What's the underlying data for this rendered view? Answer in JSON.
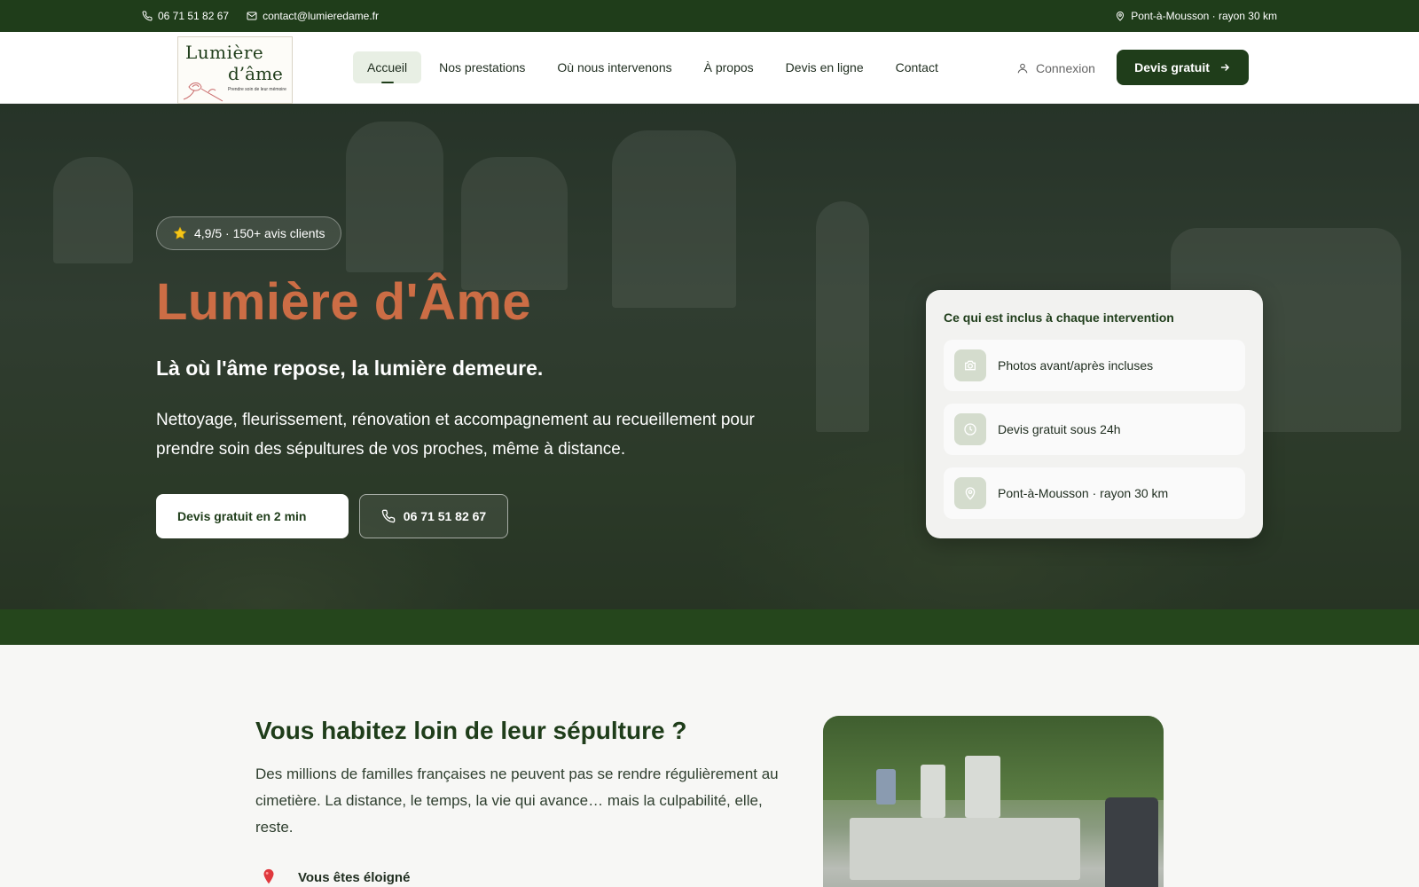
{
  "topbar": {
    "phone": "06 71 51 82 67",
    "email": "contact@lumieredame.fr",
    "location": "Pont-à-Mousson · rayon 30 km"
  },
  "logo": {
    "line1": "Lumière",
    "line2": "d’âme",
    "tagline": "Prendre soin de leur mémoire"
  },
  "nav": {
    "items": [
      {
        "label": "Accueil",
        "active": true
      },
      {
        "label": "Nos prestations"
      },
      {
        "label": "Où nous intervenons"
      },
      {
        "label": "À propos"
      },
      {
        "label": "Devis en ligne"
      },
      {
        "label": "Contact"
      }
    ],
    "login": "Connexion",
    "cta": "Devis gratuit"
  },
  "hero": {
    "rating": "4,9/5 · 150+ avis clients",
    "title": "Lumière d'Âme",
    "subtitle": "Là où l'âme repose, la lumière demeure.",
    "description": "Nettoyage, fleurissement, rénovation et accompagnement au recueillement pour prendre soin des sépultures de vos proches, même à distance.",
    "primary_button": "Devis gratuit en 2 min",
    "phone_button": "06 71 51 82 67"
  },
  "card": {
    "title": "Ce qui est inclus à chaque intervention",
    "features": [
      {
        "icon": "camera-icon",
        "label": "Photos avant/après incluses"
      },
      {
        "icon": "clock-icon",
        "label": "Devis gratuit sous 24h"
      },
      {
        "icon": "map-pin-icon",
        "label": "Pont-à-Mousson · rayon 30 km"
      }
    ]
  },
  "section": {
    "title": "Vous habitez loin de leur sépulture ?",
    "text": "Des millions de familles françaises ne peuvent pas se rendre régulièrement au cimetière. La distance, le temps, la vie qui avance… mais la culpabilité, elle, reste.",
    "bullet": "Vous êtes éloigné"
  },
  "colors": {
    "brand_green": "#1f3d1a",
    "accent_terracotta": "#cc6d45",
    "star": "#f5c518"
  }
}
